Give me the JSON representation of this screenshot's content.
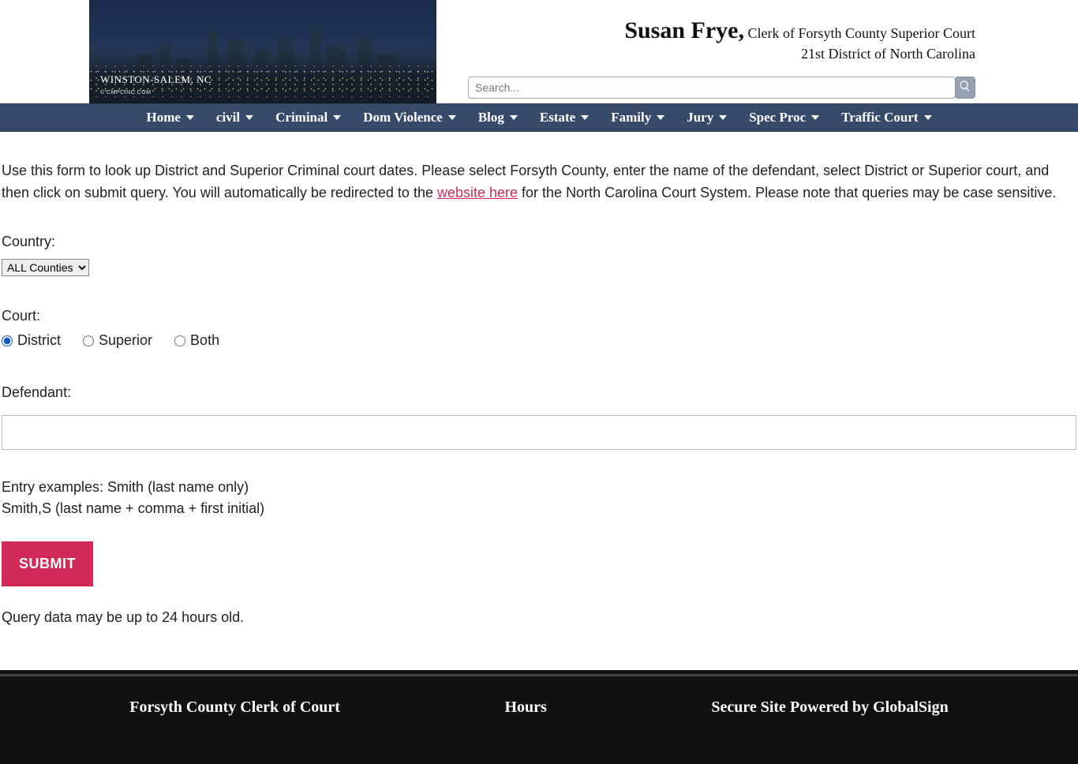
{
  "header": {
    "hero_caption": "WINSTON-SALEM, NC",
    "hero_credit": "© CMPCINC.COM",
    "title_name": "Susan Frye,",
    "title_rest": " Clerk of Forsyth County Superior Court",
    "title_sub": "21st District of North Carolina",
    "search_placeholder": "Search..."
  },
  "nav": [
    "Home",
    "civil",
    "Criminal",
    "Dom Violence",
    "Blog",
    "Estate",
    "Family",
    "Jury",
    "Spec Proc",
    "Traffic Court"
  ],
  "intro": {
    "text_before_link": "Use this form to look up District and Superior Criminal court dates. Please select Forsyth County, enter the name of the defendant, select District or Superior court, and then click on submit query. You will automatically be redirected to the ",
    "link_text": "website here",
    "text_after_link": " for the North Carolina Court System. Please note that queries may be case sensitive."
  },
  "form": {
    "country_label": "Country:",
    "country_selected": "ALL Counties",
    "court_label": "Court:",
    "court_options": [
      "District",
      "Superior",
      "Both"
    ],
    "court_selected": "District",
    "defendant_label": "Defendant:",
    "defendant_value": "",
    "example_line1": "Entry examples: Smith (last name only)",
    "example_line2": "Smith,S (last name + comma + first initial)",
    "submit_label": "SUBMIT",
    "note": "Query data may be up to 24 hours old."
  },
  "footer": {
    "col1": "Forsyth County Clerk of Court",
    "col2": "Hours",
    "col3": "Secure Site Powered by GlobalSign"
  }
}
